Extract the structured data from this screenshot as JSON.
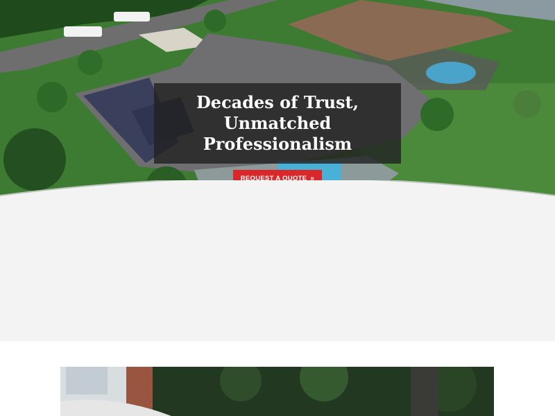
{
  "hero": {
    "headline_lines": [
      "Decades of Trust,",
      "Unmatched",
      "Professionalism"
    ],
    "cta_label": "REQUEST A QUOTE",
    "cta_icon": "double-chevron-right-icon",
    "slides": [
      {
        "active": true
      },
      {
        "active": false
      },
      {
        "active": false
      }
    ]
  },
  "colors": {
    "cta": "#d8282b",
    "overlay": "#222222",
    "band": "#f3f3f3"
  }
}
